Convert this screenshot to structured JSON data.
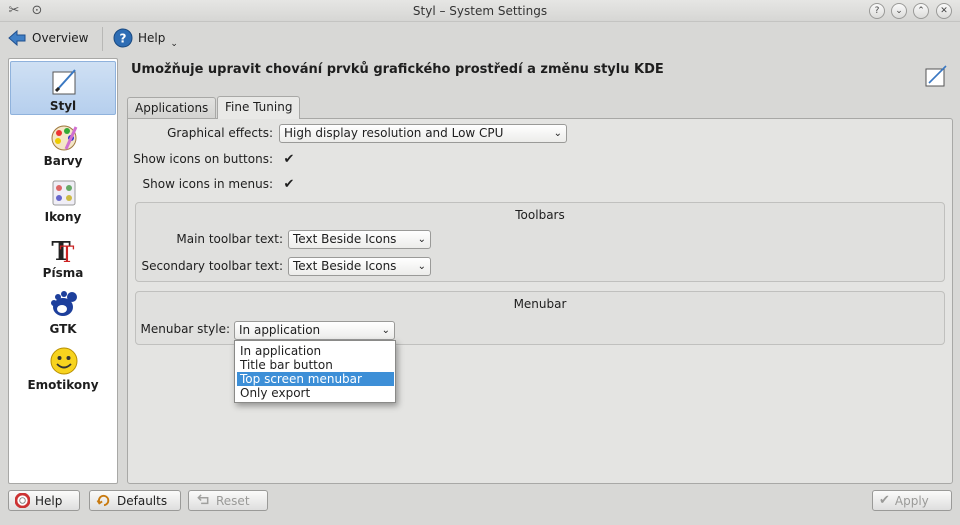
{
  "window": {
    "title": "Styl – System Settings",
    "controls": [
      "help-icon",
      "minimize-icon",
      "maximize-icon",
      "close-icon"
    ]
  },
  "toolbar": {
    "overview_label": "Overview",
    "help_label": "Help"
  },
  "sidebar": {
    "items": [
      {
        "label": "Styl",
        "icon": "style-brush-icon",
        "selected": true
      },
      {
        "label": "Barvy",
        "icon": "colors-icon",
        "selected": false
      },
      {
        "label": "Ikony",
        "icon": "icons-icon",
        "selected": false
      },
      {
        "label": "Písma",
        "icon": "fonts-icon",
        "selected": false
      },
      {
        "label": "GTK",
        "icon": "gtk-icon",
        "selected": false
      },
      {
        "label": "Emotikony",
        "icon": "smiley-icon",
        "selected": false
      }
    ]
  },
  "main": {
    "title": "Umožňuje upravit chování prvků grafického prostředí a změnu stylu KDE",
    "tabs": [
      {
        "label": "Applications",
        "active": false
      },
      {
        "label": "Fine Tuning",
        "active": true
      }
    ],
    "graphical_effects": {
      "label": "Graphical effects:",
      "value": "High display resolution and Low CPU"
    },
    "show_icons_buttons": {
      "label": "Show icons on buttons:",
      "checked": true
    },
    "show_icons_menus": {
      "label": "Show icons in menus:",
      "checked": true
    },
    "toolbars_group": {
      "title": "Toolbars",
      "main_label": "Main toolbar text:",
      "main_value": "Text Beside Icons",
      "secondary_label": "Secondary toolbar text:",
      "secondary_value": "Text Beside Icons"
    },
    "menubar_group": {
      "title": "Menubar",
      "style_label": "Menubar style:",
      "style_value": "In application",
      "options": [
        "In application",
        "Title bar button",
        "Top screen menubar",
        "Only export"
      ],
      "highlighted_option": "Top screen menubar"
    }
  },
  "bottom_buttons": {
    "help": "Help",
    "defaults": "Defaults",
    "reset": "Reset",
    "apply": "Apply"
  },
  "colors": {
    "selection": "#3d8fd7",
    "sidebar_selected": "#b6cfee"
  }
}
